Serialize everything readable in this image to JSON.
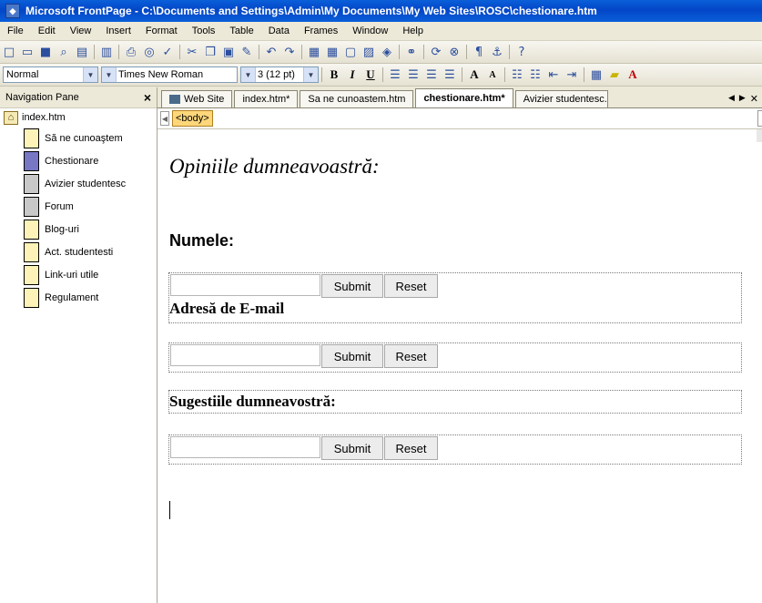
{
  "window": {
    "title": "Microsoft FrontPage - C:\\Documents and Settings\\Admin\\My Documents\\My Web Sites\\ROSC\\chestionare.htm"
  },
  "menu": [
    "File",
    "Edit",
    "View",
    "Insert",
    "Format",
    "Tools",
    "Table",
    "Data",
    "Frames",
    "Window",
    "Help"
  ],
  "format_toolbar": {
    "style": "Normal",
    "font": "Times New Roman",
    "size": "3 (12 pt)"
  },
  "nav_pane": {
    "title": "Navigation Pane",
    "close": "×",
    "root": "index.htm",
    "items": [
      "Să ne cunoaştem",
      "Chestionare",
      "Avizier studentesc",
      "Forum",
      "Blog-uri",
      "Act. studentesti",
      "Link-uri utile",
      "Regulament"
    ]
  },
  "tabs": [
    "Web Site",
    "index.htm*",
    "Sa ne cunoastem.htm",
    "chestionare.htm*",
    "Avizier studentesc.htm"
  ],
  "quick_tag": "<body>",
  "page": {
    "heading": "Opiniile dumneavoastră:",
    "name_label": "Numele:",
    "email_label": "Adresă de E-mail",
    "suggestions_label": "Sugestiile dumneavostră:",
    "submit": "Submit",
    "reset": "Reset"
  },
  "colors": {
    "titlebar": "#0a5fd9",
    "selected_page": "#7777c4",
    "quick_tag": "#ffd77a"
  }
}
